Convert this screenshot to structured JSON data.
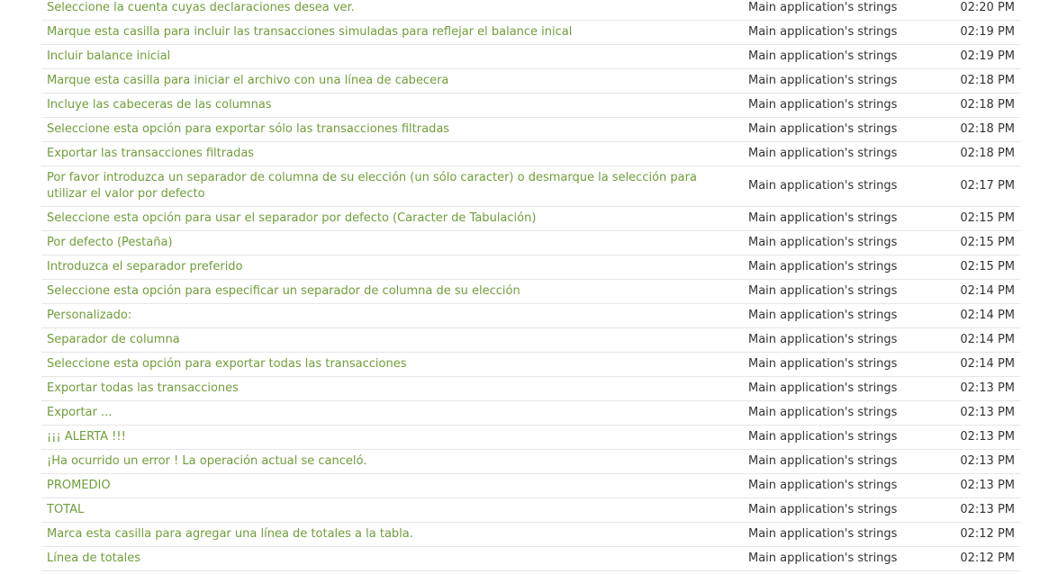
{
  "colors": {
    "link": "#6f9e3a",
    "text": "#333333",
    "divider": "#e6e6e6"
  },
  "rows": [
    {
      "text": "Seleccione la cuenta cuyas declaraciones desea ver.",
      "resource": "Main application's strings",
      "time": "02:20 PM"
    },
    {
      "text": "Marque esta casilla para incluir las transacciones simuladas para reflejar el balance inical",
      "resource": "Main application's strings",
      "time": "02:19 PM"
    },
    {
      "text": "Incluir balance inicial",
      "resource": "Main application's strings",
      "time": "02:19 PM"
    },
    {
      "text": "Marque esta casilla para iniciar el archivo con una línea de cabecera",
      "resource": "Main application's strings",
      "time": "02:18 PM"
    },
    {
      "text": "Incluye las cabeceras de las columnas",
      "resource": "Main application's strings",
      "time": "02:18 PM"
    },
    {
      "text": "Seleccione esta opción para exportar sólo las transacciones filtradas",
      "resource": "Main application's strings",
      "time": "02:18 PM"
    },
    {
      "text": "Exportar las transacciones filtradas",
      "resource": "Main application's strings",
      "time": "02:18 PM"
    },
    {
      "text": "Por favor introduzca un separador de columna de su elección (un sólo caracter) o desmarque la selección para utilizar el valor por defecto",
      "resource": "Main application's strings",
      "time": "02:17 PM"
    },
    {
      "text": "Seleccione esta opción para usar el separador por defecto (Caracter de Tabulación)",
      "resource": "Main application's strings",
      "time": "02:15 PM"
    },
    {
      "text": "Por defecto (Pestaña)",
      "resource": "Main application's strings",
      "time": "02:15 PM"
    },
    {
      "text": "Introduzca el separador preferido",
      "resource": "Main application's strings",
      "time": "02:15 PM"
    },
    {
      "text": "Seleccione esta opción para especificar un separador de columna de su elección",
      "resource": "Main application's strings",
      "time": "02:14 PM"
    },
    {
      "text": "Personalizado:",
      "resource": "Main application's strings",
      "time": "02:14 PM"
    },
    {
      "text": "Separador de columna",
      "resource": "Main application's strings",
      "time": "02:14 PM"
    },
    {
      "text": "Seleccione esta opción para exportar todas las transacciones",
      "resource": "Main application's strings",
      "time": "02:14 PM"
    },
    {
      "text": "Exportar todas las transacciones",
      "resource": "Main application's strings",
      "time": "02:13 PM"
    },
    {
      "text": "Exportar ...",
      "resource": "Main application's strings",
      "time": "02:13 PM"
    },
    {
      "text": "¡¡¡ ALERTA !!!",
      "resource": "Main application's strings",
      "time": "02:13 PM"
    },
    {
      "text": "¡Ha ocurrido un error ! La operación actual se canceló.",
      "resource": "Main application's strings",
      "time": "02:13 PM"
    },
    {
      "text": "PROMEDIO",
      "resource": "Main application's strings",
      "time": "02:13 PM"
    },
    {
      "text": "TOTAL",
      "resource": "Main application's strings",
      "time": "02:13 PM"
    },
    {
      "text": "Marca esta casilla para agregar una línea de totales a la tabla.",
      "resource": "Main application's strings",
      "time": "02:12 PM"
    },
    {
      "text": "Línea de totales",
      "resource": "Main application's strings",
      "time": "02:12 PM"
    }
  ]
}
